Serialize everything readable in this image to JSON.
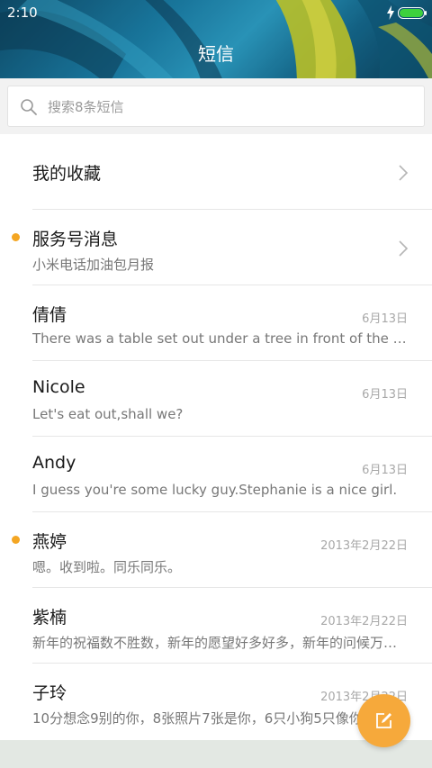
{
  "status_bar": {
    "time": "2:10"
  },
  "header": {
    "title": "短信"
  },
  "search": {
    "placeholder": "搜索8条短信"
  },
  "conversations": [
    {
      "name": "我的收藏",
      "preview": "",
      "date": "",
      "unread": false,
      "chevron": true
    },
    {
      "name": "服务号消息",
      "preview": "小米电话加油包月报",
      "date": "",
      "unread": true,
      "chevron": true
    },
    {
      "name": "倩倩",
      "preview": "There was a table set out under a tree in front of the house...",
      "date": "6月13日",
      "unread": false,
      "chevron": false
    },
    {
      "name": "Nicole",
      "preview": "Let's eat out,shall we?",
      "date": "6月13日",
      "unread": false,
      "chevron": false
    },
    {
      "name": "Andy",
      "preview": "I guess you're some lucky guy.Stephanie is a nice girl.",
      "date": "6月13日",
      "unread": false,
      "chevron": false
    },
    {
      "name": "燕婷",
      "preview": "嗯。收到啦。同乐同乐。",
      "date": "2013年2月22日",
      "unread": true,
      "chevron": false
    },
    {
      "name": "紫楠",
      "preview": "新年的祝福数不胜数，新年的愿望好多好多，新年的问候万万千千",
      "date": "2013年2月22日",
      "unread": false,
      "chevron": false
    },
    {
      "name": "子玲",
      "preview": "10分想念9别的你，8张照片7张是你，6只小狗5只像你",
      "date": "2013年2月22日",
      "unread": false,
      "chevron": false
    }
  ],
  "colors": {
    "accent": "#f6a93b",
    "unread_dot": "#f4a623",
    "battery": "#3dd13d"
  },
  "icons": {
    "search": "search-icon",
    "chevron": "chevron-right-icon",
    "compose": "compose-icon",
    "battery": "battery-icon",
    "charge": "charge-icon"
  }
}
